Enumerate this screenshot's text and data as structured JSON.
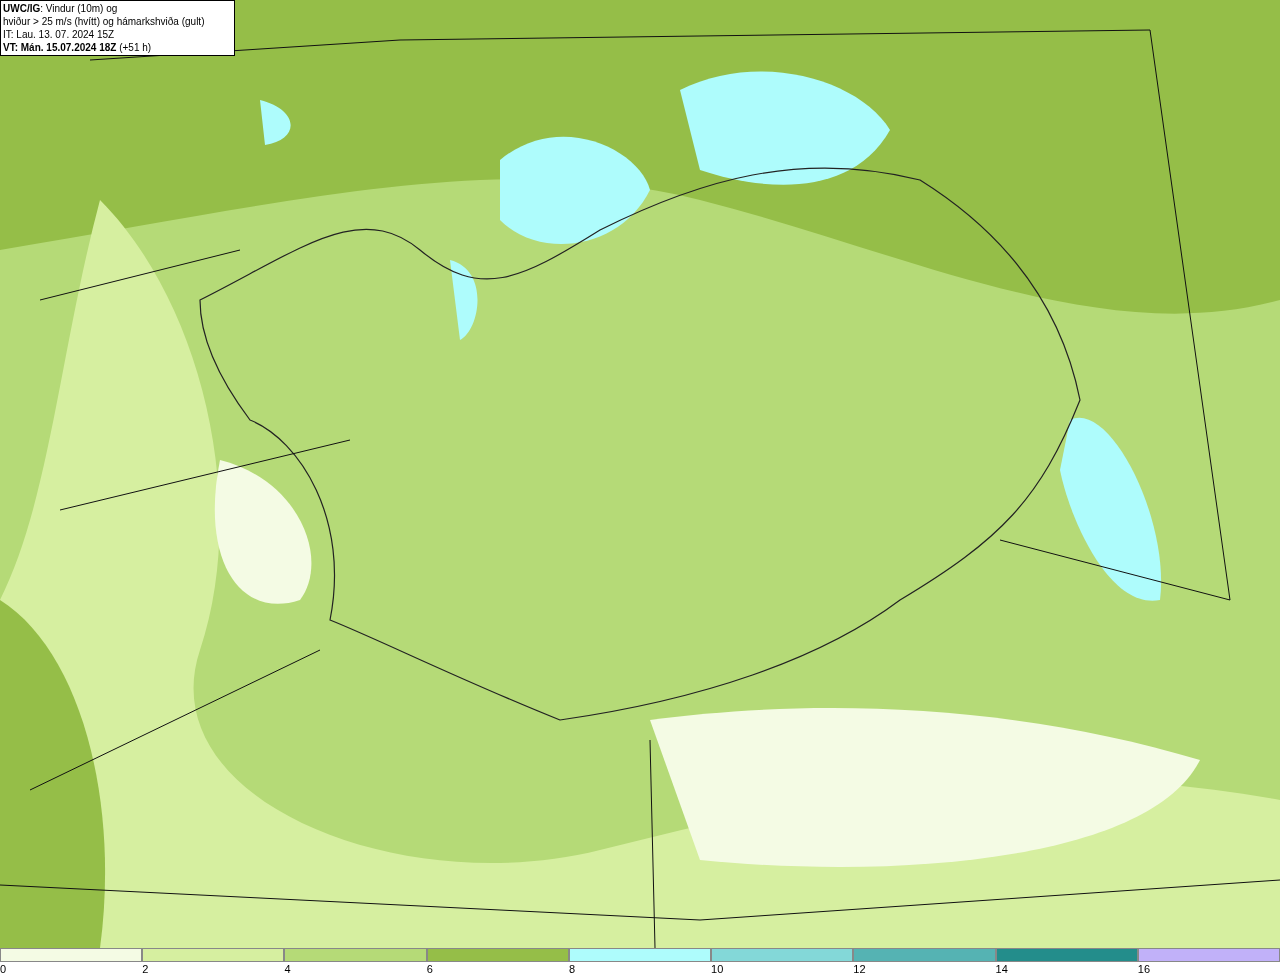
{
  "info_box": {
    "lines": [
      "**UWC/IG**: Vindur (10m) og",
      "hviður > 25 m/s (hvítt) og hámarkshviða (gult)",
      "IT: Lau. 13. 07. 2024 15Z",
      "**VT: Mán. 15.07.2024 18Z** (+51 h)"
    ]
  },
  "legend": [
    {
      "label": "0",
      "color": "#f4fbe4"
    },
    {
      "label": "2",
      "color": "#d6efa0"
    },
    {
      "label": "4",
      "color": "#b5da77"
    },
    {
      "label": "6",
      "color": "#95be48"
    },
    {
      "label": "8",
      "color": "#aefcfc"
    },
    {
      "label": "10",
      "color": "#83d8d8"
    },
    {
      "label": "12",
      "color": "#55b3b3"
    },
    {
      "label": "14",
      "color": "#238d8b"
    },
    {
      "label": "16",
      "color": "#c1b1f9"
    }
  ]
}
